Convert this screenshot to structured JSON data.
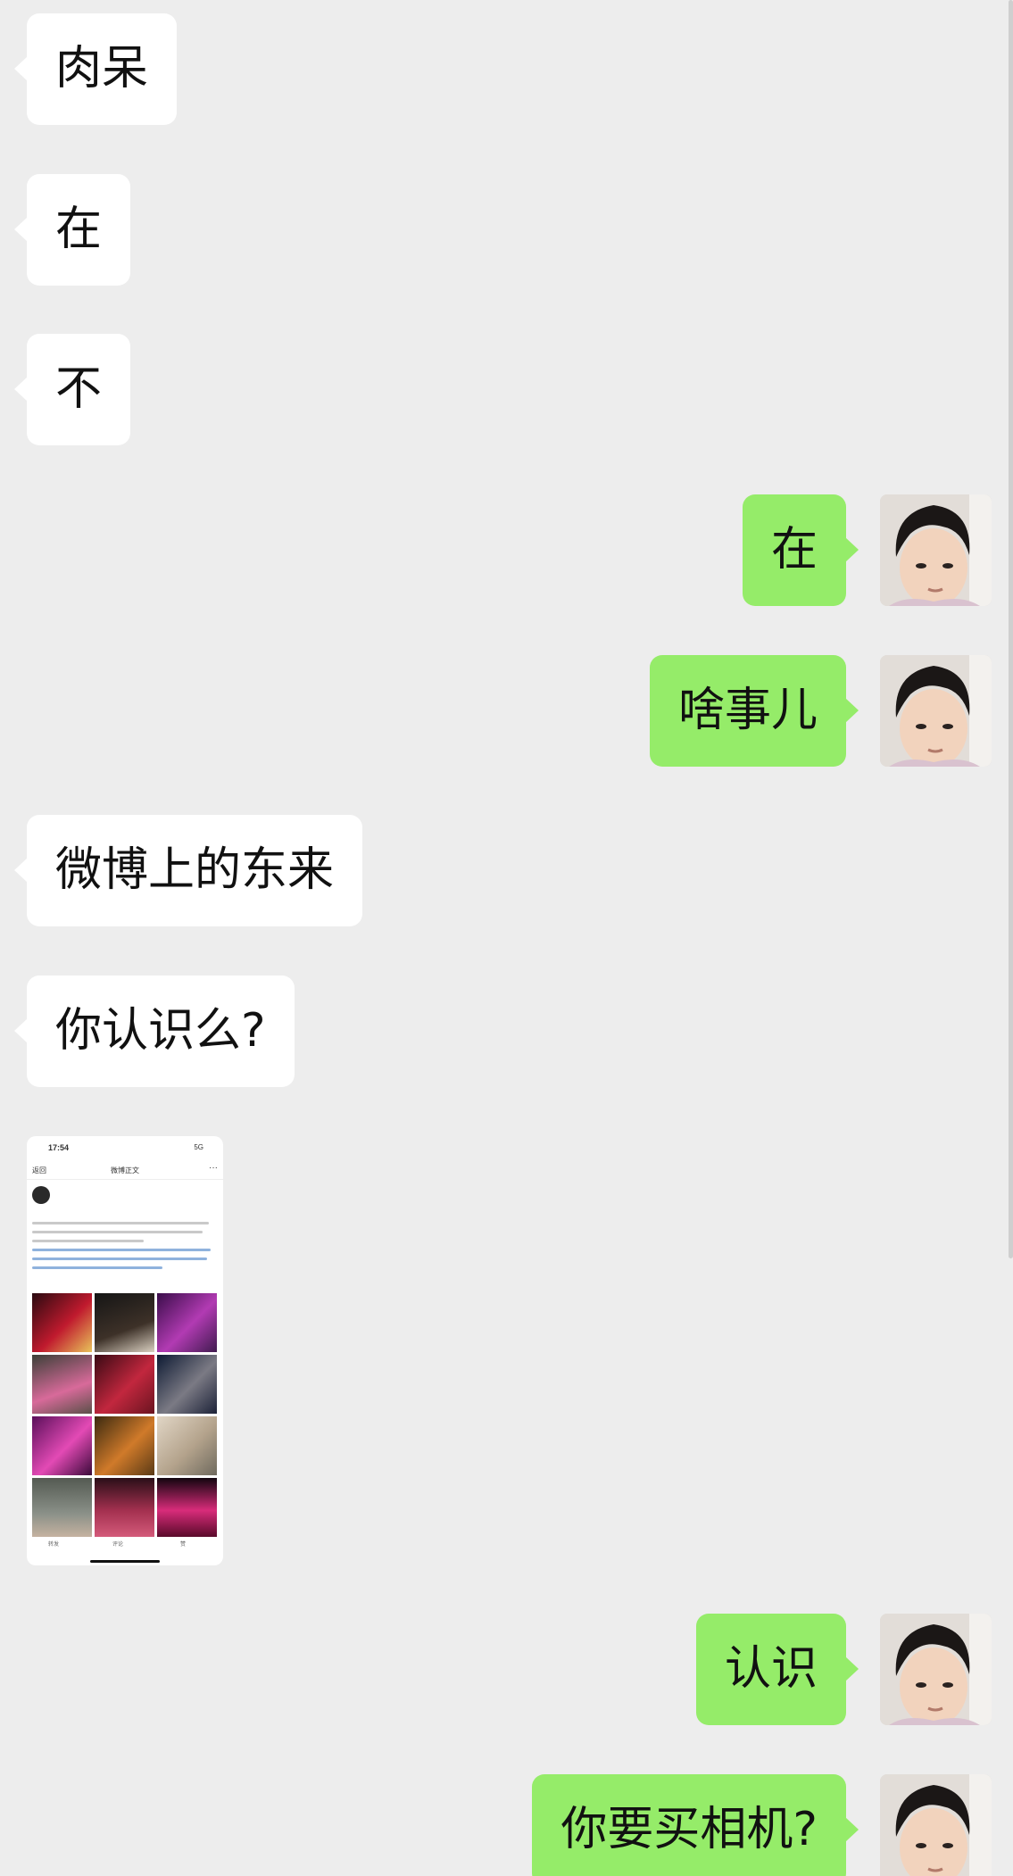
{
  "colors": {
    "background": "#ededed",
    "incoming_bubble": "#ffffff",
    "outgoing_bubble": "#95ec69",
    "text": "#111111"
  },
  "messages": [
    {
      "direction": "in",
      "text": "肉呆"
    },
    {
      "direction": "in",
      "text": "在"
    },
    {
      "direction": "in",
      "text": "不"
    },
    {
      "direction": "out",
      "text": "在"
    },
    {
      "direction": "out",
      "text": "啥事儿"
    },
    {
      "direction": "in",
      "text": "微博上的东来"
    },
    {
      "direction": "in",
      "text": "你认识么?"
    },
    {
      "direction": "in",
      "type": "image"
    },
    {
      "direction": "out",
      "text": "认识"
    },
    {
      "direction": "out",
      "text": "你要买相机?"
    }
  ],
  "screenshot_thumb": {
    "time": "17:54",
    "network": "5G",
    "nav_back": "返回",
    "nav_title": "微博正文",
    "nav_more": "···",
    "tabs": [
      "转发",
      "评论",
      "赞"
    ]
  },
  "avatar_icon": "user-avatar-photo"
}
